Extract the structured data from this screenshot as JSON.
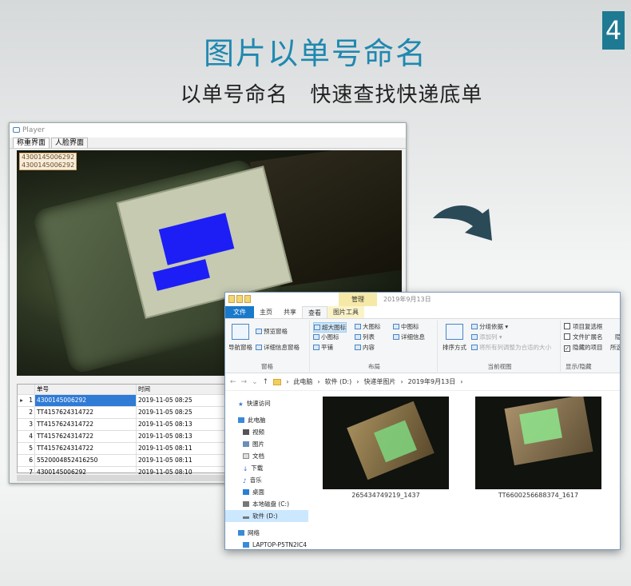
{
  "page": {
    "number": "4",
    "title": "图片以单号命名",
    "subtitle": "以单号命名   快速查找快递底单",
    "accent_color": "#1f88b0"
  },
  "player": {
    "title": "Player",
    "tabs": [
      "称重界面",
      "人脸界面"
    ],
    "ocr_tag_lines": [
      "4300145006292",
      "4300145006292"
    ],
    "grid": {
      "columns": [
        "单号",
        "时间"
      ],
      "rows": [
        {
          "num": "1",
          "order": "4300145006292",
          "time": "2019-11-05 08:25",
          "selected": true
        },
        {
          "num": "2",
          "order": "TT4157624314722",
          "time": "2019-11-05 08:25"
        },
        {
          "num": "3",
          "order": "TT4157624314722",
          "time": "2019-11-05 08:13"
        },
        {
          "num": "4",
          "order": "TT4157624314722",
          "time": "2019-11-05 08:13"
        },
        {
          "num": "5",
          "order": "TT4157624314722",
          "time": "2019-11-05 08:11"
        },
        {
          "num": "6",
          "order": "5520004852416250",
          "time": "2019-11-05 08:11"
        },
        {
          "num": "7",
          "order": "4300145006292",
          "time": "2019-11-05 08:10"
        }
      ]
    }
  },
  "explorer": {
    "manage_label": "管理",
    "window_title": "2019年9月13日",
    "tabs": {
      "file": "文件",
      "home": "主页",
      "share": "共享",
      "view": "查看",
      "picture_tools": "图片工具"
    },
    "ribbon": {
      "pane_group": {
        "label": "窗格",
        "nav_pane": "导航窗格",
        "preview_pane": "预览窗格",
        "details_pane": "详细信息窗格"
      },
      "layout_group": {
        "label": "布局",
        "xl_icons": "超大图标",
        "large_icons": "大图标",
        "medium_icons": "中图标",
        "small_icons": "小图标",
        "list": "列表",
        "details": "详细信息",
        "tiles": "平铺",
        "content": "内容"
      },
      "current_view_group": {
        "label": "当前视图",
        "sort_by": "排序方式",
        "group_by": "分组依据",
        "add_columns": "添加列",
        "size_all_columns": "将所有列调整为合适的大小"
      },
      "show_hide_group": {
        "label": "显示/隐藏",
        "item_checkboxes": "项目复选框",
        "file_name_extensions": "文件扩展名",
        "hidden_items": "隐藏的项目",
        "hide_selected": "隐",
        "selected_items": "所选"
      }
    },
    "address": [
      "此电脑",
      "软件 (D:)",
      "快递单图片",
      "2019年9月13日"
    ],
    "nav": {
      "quick_access": "快速访问",
      "this_pc": "此电脑",
      "videos": "视频",
      "pictures": "图片",
      "documents": "文档",
      "downloads": "下载",
      "music": "音乐",
      "desktop": "桌面",
      "local_disk": "本地磁盘 (C:)",
      "software_disk": "软件 (D:)",
      "network": "网络",
      "laptop": "LAPTOP-P5TN2IC4"
    },
    "files": [
      {
        "name": "265434749219_1437"
      },
      {
        "name": "TT6600256688374_1617"
      }
    ]
  }
}
